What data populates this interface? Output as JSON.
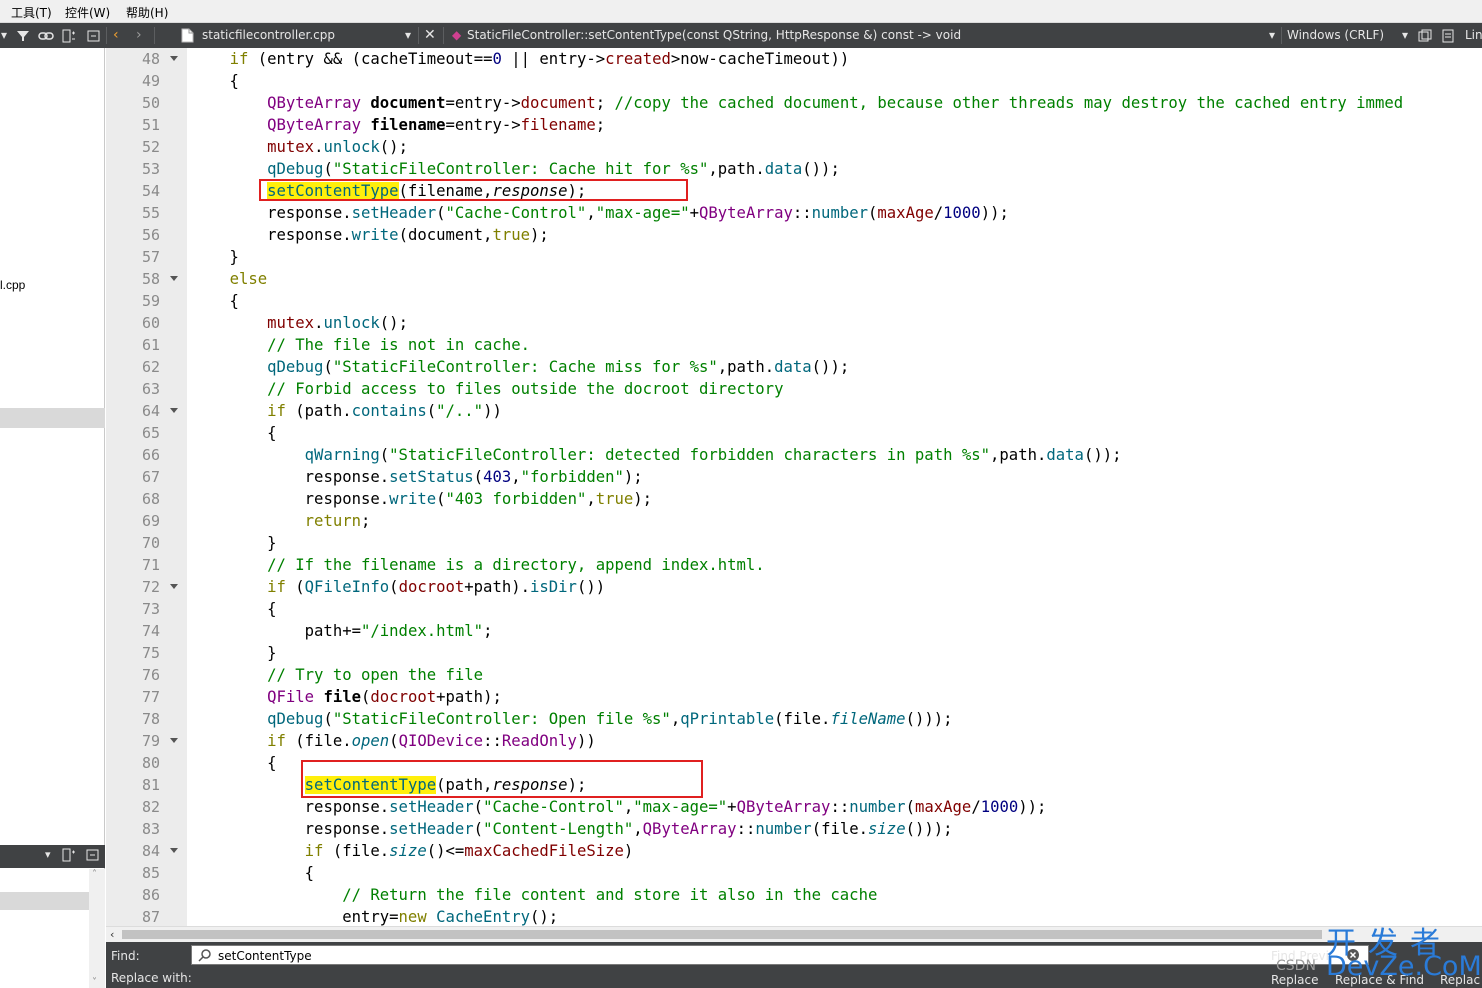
{
  "menubar": {
    "items": [
      "工具(T)",
      "控件(W)",
      "帮助(H)"
    ]
  },
  "toolbar": {
    "filename": "staticfilecontroller.cpp",
    "symbol": "StaticFileController::setContentType(const QString, HttpResponse &) const -> void",
    "line_ending": "Windows (CRLF)",
    "position_label": "Lin"
  },
  "sidebar": {
    "file_fragment": "l.cpp"
  },
  "editor": {
    "lines": [
      {
        "n": "48",
        "fold": true
      },
      {
        "n": "49",
        "fold": false
      },
      {
        "n": "50",
        "fold": false
      },
      {
        "n": "51",
        "fold": false
      },
      {
        "n": "52",
        "fold": false
      },
      {
        "n": "53",
        "fold": false
      },
      {
        "n": "54",
        "fold": false
      },
      {
        "n": "55",
        "fold": false
      },
      {
        "n": "56",
        "fold": false
      },
      {
        "n": "57",
        "fold": false
      },
      {
        "n": "58",
        "fold": true
      },
      {
        "n": "59",
        "fold": false
      },
      {
        "n": "60",
        "fold": false
      },
      {
        "n": "61",
        "fold": false
      },
      {
        "n": "62",
        "fold": false
      },
      {
        "n": "63",
        "fold": false
      },
      {
        "n": "64",
        "fold": true
      },
      {
        "n": "65",
        "fold": false
      },
      {
        "n": "66",
        "fold": false
      },
      {
        "n": "67",
        "fold": false
      },
      {
        "n": "68",
        "fold": false
      },
      {
        "n": "69",
        "fold": false
      },
      {
        "n": "70",
        "fold": false
      },
      {
        "n": "71",
        "fold": false
      },
      {
        "n": "72",
        "fold": true
      },
      {
        "n": "73",
        "fold": false
      },
      {
        "n": "74",
        "fold": false
      },
      {
        "n": "75",
        "fold": false
      },
      {
        "n": "76",
        "fold": false
      },
      {
        "n": "77",
        "fold": false
      },
      {
        "n": "78",
        "fold": false
      },
      {
        "n": "79",
        "fold": true
      },
      {
        "n": "80",
        "fold": false
      },
      {
        "n": "81",
        "fold": false
      },
      {
        "n": "82",
        "fold": false
      },
      {
        "n": "83",
        "fold": false
      },
      {
        "n": "84",
        "fold": true
      },
      {
        "n": "85",
        "fold": false
      },
      {
        "n": "86",
        "fold": false
      },
      {
        "n": "87",
        "fold": false
      }
    ],
    "code": [
      [
        [
          "    ",
          ""
        ],
        [
          "if",
          "kw"
        ],
        [
          " (entry && (",
          ""
        ],
        [
          "cacheTimeout",
          ""
        ],
        [
          "==",
          ""
        ],
        [
          "0",
          "num"
        ],
        [
          " || entry->",
          ""
        ],
        [
          "created",
          "mb"
        ],
        [
          ">now-cacheTimeout))",
          ""
        ]
      ],
      [
        [
          "    {",
          ""
        ]
      ],
      [
        [
          "        ",
          ""
        ],
        [
          "QByteArray",
          "ty"
        ],
        [
          " ",
          ""
        ],
        [
          "document",
          "bd"
        ],
        [
          "=entry->",
          ""
        ],
        [
          "document",
          "mb"
        ],
        [
          ";",
          ""
        ],
        [
          " //copy the cached document, because other threads may destroy the cached entry immed",
          "cm"
        ]
      ],
      [
        [
          "        ",
          ""
        ],
        [
          "QByteArray",
          "ty"
        ],
        [
          " ",
          ""
        ],
        [
          "filename",
          "bd"
        ],
        [
          "=entry->",
          ""
        ],
        [
          "filename",
          "mb"
        ],
        [
          ";",
          ""
        ]
      ],
      [
        [
          "        ",
          ""
        ],
        [
          "mutex",
          "mb"
        ],
        [
          ".",
          ""
        ],
        [
          "unlock",
          "fn"
        ],
        [
          "();",
          ""
        ]
      ],
      [
        [
          "        ",
          ""
        ],
        [
          "qDebug",
          "fn"
        ],
        [
          "(",
          ""
        ],
        [
          "\"StaticFileController: Cache hit for %s\"",
          "str"
        ],
        [
          ",path.",
          ""
        ],
        [
          "data",
          "fn"
        ],
        [
          "());",
          ""
        ]
      ],
      [
        [
          "        ",
          ""
        ],
        [
          "setContentType",
          "fn hl"
        ],
        [
          "(filename,",
          ""
        ],
        [
          "response",
          "it"
        ],
        [
          ");",
          ""
        ]
      ],
      [
        [
          "        ",
          ""
        ],
        [
          "response",
          ""
        ],
        [
          ".",
          ""
        ],
        [
          "setHeader",
          "fn"
        ],
        [
          "(",
          ""
        ],
        [
          "\"Cache-Control\"",
          "str"
        ],
        [
          ",",
          ""
        ],
        [
          "\"max-age=\"",
          "str"
        ],
        [
          "+",
          ""
        ],
        [
          "QByteArray",
          "ty"
        ],
        [
          "::",
          ""
        ],
        [
          "number",
          "fn"
        ],
        [
          "(",
          ""
        ],
        [
          "maxAge",
          "mb"
        ],
        [
          "/",
          ""
        ],
        [
          "1000",
          "num"
        ],
        [
          "));",
          ""
        ]
      ],
      [
        [
          "        ",
          ""
        ],
        [
          "response",
          ""
        ],
        [
          ".",
          ""
        ],
        [
          "write",
          "fn"
        ],
        [
          "(document,",
          ""
        ],
        [
          "true",
          "kw"
        ],
        [
          ");",
          ""
        ]
      ],
      [
        [
          "    }",
          ""
        ]
      ],
      [
        [
          "    ",
          ""
        ],
        [
          "else",
          "kw"
        ]
      ],
      [
        [
          "    {",
          ""
        ]
      ],
      [
        [
          "        ",
          ""
        ],
        [
          "mutex",
          "mb"
        ],
        [
          ".",
          ""
        ],
        [
          "unlock",
          "fn"
        ],
        [
          "();",
          ""
        ]
      ],
      [
        [
          "        ",
          ""
        ],
        [
          "// The file is not in cache.",
          "cm"
        ]
      ],
      [
        [
          "        ",
          ""
        ],
        [
          "qDebug",
          "fn"
        ],
        [
          "(",
          ""
        ],
        [
          "\"StaticFileController: Cache miss for %s\"",
          "str"
        ],
        [
          ",path.",
          ""
        ],
        [
          "data",
          "fn"
        ],
        [
          "());",
          ""
        ]
      ],
      [
        [
          "        ",
          ""
        ],
        [
          "// Forbid access to files outside the docroot directory",
          "cm"
        ]
      ],
      [
        [
          "        ",
          ""
        ],
        [
          "if",
          "kw"
        ],
        [
          " (path.",
          ""
        ],
        [
          "contains",
          "fn"
        ],
        [
          "(",
          ""
        ],
        [
          "\"/..\"",
          "str"
        ],
        [
          "))",
          ""
        ]
      ],
      [
        [
          "        {",
          ""
        ]
      ],
      [
        [
          "            ",
          ""
        ],
        [
          "qWarning",
          "fn"
        ],
        [
          "(",
          ""
        ],
        [
          "\"StaticFileController: detected forbidden characters in path %s\"",
          "str"
        ],
        [
          ",path.",
          ""
        ],
        [
          "data",
          "fn"
        ],
        [
          "());",
          ""
        ]
      ],
      [
        [
          "            ",
          ""
        ],
        [
          "response",
          ""
        ],
        [
          ".",
          ""
        ],
        [
          "setStatus",
          "fn"
        ],
        [
          "(",
          ""
        ],
        [
          "403",
          "num"
        ],
        [
          ",",
          ""
        ],
        [
          "\"forbidden\"",
          "str"
        ],
        [
          ");",
          ""
        ]
      ],
      [
        [
          "            ",
          ""
        ],
        [
          "response",
          ""
        ],
        [
          ".",
          ""
        ],
        [
          "write",
          "fn"
        ],
        [
          "(",
          ""
        ],
        [
          "\"403 forbidden\"",
          "str"
        ],
        [
          ",",
          ""
        ],
        [
          "true",
          "kw"
        ],
        [
          ");",
          ""
        ]
      ],
      [
        [
          "            ",
          ""
        ],
        [
          "return",
          "kw"
        ],
        [
          ";",
          ""
        ]
      ],
      [
        [
          "        }",
          ""
        ]
      ],
      [
        [
          "        ",
          ""
        ],
        [
          "// If the filename is a directory, append index.html.",
          "cm"
        ]
      ],
      [
        [
          "        ",
          ""
        ],
        [
          "if",
          "kw"
        ],
        [
          " (",
          ""
        ],
        [
          "QFileInfo",
          "fn"
        ],
        [
          "(",
          ""
        ],
        [
          "docroot",
          "mb"
        ],
        [
          "+path).",
          ""
        ],
        [
          "isDir",
          "fn"
        ],
        [
          "())",
          ""
        ]
      ],
      [
        [
          "        {",
          ""
        ]
      ],
      [
        [
          "            path+=",
          ""
        ],
        [
          "\"/index.html\"",
          "str"
        ],
        [
          ";",
          ""
        ]
      ],
      [
        [
          "        }",
          ""
        ]
      ],
      [
        [
          "        ",
          ""
        ],
        [
          "// Try to open the file",
          "cm"
        ]
      ],
      [
        [
          "        ",
          ""
        ],
        [
          "QFile",
          "ty"
        ],
        [
          " ",
          ""
        ],
        [
          "file",
          "bd"
        ],
        [
          "(",
          ""
        ],
        [
          "docroot",
          "mb"
        ],
        [
          "+path);",
          ""
        ]
      ],
      [
        [
          "        ",
          ""
        ],
        [
          "qDebug",
          "fn"
        ],
        [
          "(",
          ""
        ],
        [
          "\"StaticFileController: Open file %s\"",
          "str"
        ],
        [
          ",",
          ""
        ],
        [
          "qPrintable",
          "fn"
        ],
        [
          "(file.",
          ""
        ],
        [
          "fileName",
          "fn it"
        ],
        [
          "()));",
          ""
        ]
      ],
      [
        [
          "        ",
          ""
        ],
        [
          "if",
          "kw"
        ],
        [
          " (file.",
          ""
        ],
        [
          "open",
          "fn it"
        ],
        [
          "(",
          ""
        ],
        [
          "QIODevice",
          "ty"
        ],
        [
          "::",
          ""
        ],
        [
          "ReadOnly",
          "ty"
        ],
        [
          "))",
          ""
        ]
      ],
      [
        [
          "        {",
          ""
        ]
      ],
      [
        [
          "            ",
          ""
        ],
        [
          "setContentType",
          "fn hl"
        ],
        [
          "(path,",
          ""
        ],
        [
          "response",
          "it"
        ],
        [
          ");",
          ""
        ]
      ],
      [
        [
          "            ",
          ""
        ],
        [
          "response",
          ""
        ],
        [
          ".",
          ""
        ],
        [
          "setHeader",
          "fn"
        ],
        [
          "(",
          ""
        ],
        [
          "\"Cache-Control\"",
          "str"
        ],
        [
          ",",
          ""
        ],
        [
          "\"max-age=\"",
          "str"
        ],
        [
          "+",
          ""
        ],
        [
          "QByteArray",
          "ty"
        ],
        [
          "::",
          ""
        ],
        [
          "number",
          "fn"
        ],
        [
          "(",
          ""
        ],
        [
          "maxAge",
          "mb"
        ],
        [
          "/",
          ""
        ],
        [
          "1000",
          "num"
        ],
        [
          "));",
          ""
        ]
      ],
      [
        [
          "            ",
          ""
        ],
        [
          "response",
          ""
        ],
        [
          ".",
          ""
        ],
        [
          "setHeader",
          "fn"
        ],
        [
          "(",
          ""
        ],
        [
          "\"Content-Length\"",
          "str"
        ],
        [
          ",",
          ""
        ],
        [
          "QByteArray",
          "ty"
        ],
        [
          "::",
          ""
        ],
        [
          "number",
          "fn"
        ],
        [
          "(file.",
          ""
        ],
        [
          "size",
          "fn it"
        ],
        [
          "()));",
          ""
        ]
      ],
      [
        [
          "            ",
          ""
        ],
        [
          "if",
          "kw"
        ],
        [
          " (file.",
          ""
        ],
        [
          "size",
          "fn it"
        ],
        [
          "()<=",
          ""
        ],
        [
          "maxCachedFileSize",
          "mb"
        ],
        [
          ")",
          ""
        ]
      ],
      [
        [
          "            {",
          ""
        ]
      ],
      [
        [
          "                ",
          ""
        ],
        [
          "// Return the file content and store it also in the cache",
          "cm"
        ]
      ],
      [
        [
          "                entry=",
          ""
        ],
        [
          "new",
          "kw"
        ],
        [
          " ",
          ""
        ],
        [
          "CacheEntry",
          "fn"
        ],
        [
          "();",
          ""
        ]
      ]
    ]
  },
  "findpanel": {
    "find_label": "Find:",
    "replace_label": "Replace with:",
    "find_value": "setContentType",
    "find_prev_label": "Find Previ",
    "replace_label_btn": "Replace",
    "replace_find_label": "Replace & Find",
    "replace_all_label": "Replac"
  },
  "watermark": {
    "cn": "开发者",
    "en": "DevZe.CoM",
    "csdn": "CSDN"
  }
}
